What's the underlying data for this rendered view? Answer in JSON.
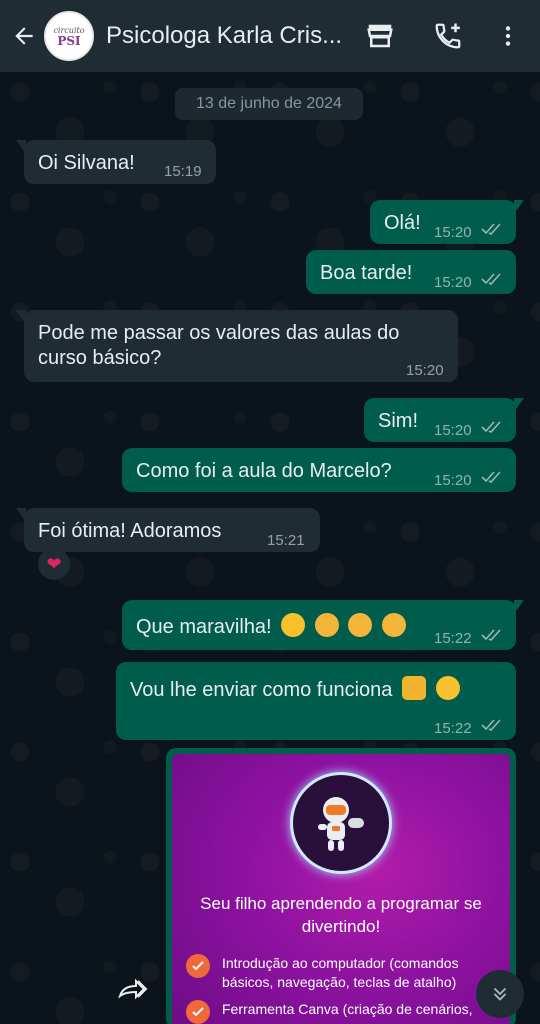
{
  "header": {
    "contact_name": "Psicologa Karla Cris...",
    "avatar_small": "circuito",
    "avatar_big": "PSI"
  },
  "chat": {
    "date": "13 de junho de 2024",
    "messages": [
      {
        "dir": "in",
        "text": "Oi Silvana!",
        "time": "15:19"
      },
      {
        "dir": "out",
        "text": "Olá!",
        "time": "15:20"
      },
      {
        "dir": "out",
        "text": "Boa tarde!",
        "time": "15:20"
      },
      {
        "dir": "in",
        "text_line1": "Pode me passar os valores das aulas do",
        "text_line2": "curso básico?",
        "time": "15:20"
      },
      {
        "dir": "out",
        "text": "Sim!",
        "time": "15:20"
      },
      {
        "dir": "out",
        "text": "Como foi a aula do Marcelo?",
        "time": "15:20"
      },
      {
        "dir": "in",
        "text": "Foi ótima! Adoramos",
        "time": "15:21",
        "reaction": "❤"
      },
      {
        "dir": "out",
        "text": "Que maravilha!",
        "time": "15:22"
      },
      {
        "dir": "out",
        "text": "Vou lhe enviar como funciona",
        "time": "15:22"
      }
    ],
    "image": {
      "headline_line1": "Seu filho aprendendo a programar se",
      "headline_line2": "divertindo!",
      "items": [
        "Introdução ao computador (comandos básicos, navegação, teclas de atalho)",
        "Ferramenta Canva (criação de cenários,"
      ]
    }
  },
  "colors": {
    "header_bg": "#1f2c34",
    "incoming_bubble": "#1f2c34",
    "outgoing_bubble": "#005c4b",
    "tick_color": "#9ab8b2",
    "poster_accent": "#f0693a"
  },
  "icons": [
    "back-arrow-icon",
    "store-icon",
    "add-call-icon",
    "more-vert-icon",
    "double-check-icon",
    "forward-icon",
    "chevrons-down-icon",
    "heart-icon"
  ]
}
